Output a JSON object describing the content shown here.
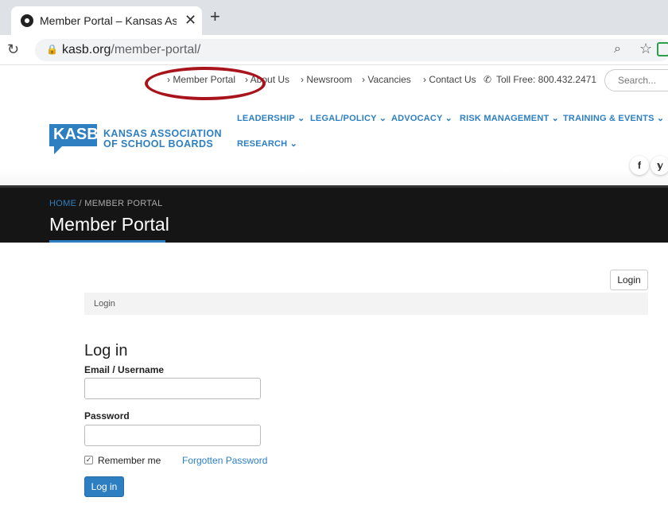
{
  "browser": {
    "tab_title": "Member Portal – Kansas Associa",
    "tab_close": "✕",
    "new_tab": "+",
    "url_domain": "kasb.org",
    "url_path": "/member-portal/"
  },
  "util_nav": {
    "items": [
      {
        "label": "› Member Portal"
      },
      {
        "label": "› About Us"
      },
      {
        "label": "› Newsroom"
      },
      {
        "label": "› Vacancies"
      },
      {
        "label": "› Contact Us"
      }
    ],
    "phone": "Toll Free: 800.432.2471",
    "search_placeholder": "Search..."
  },
  "header": {
    "logo_mark": "KASB",
    "logo_line1": "KANSAS ASSOCIATION",
    "logo_line2": "OF SCHOOL BOARDS",
    "main_nav": [
      {
        "label": "LEADERSHIP ⌄"
      },
      {
        "label": "LEGAL/POLICY ⌄"
      },
      {
        "label": "ADVOCACY ⌄"
      },
      {
        "label": "RISK MANAGEMENT ⌄"
      },
      {
        "label": "TRAINING & EVENTS ⌄"
      },
      {
        "label": "RESEARCH ⌄"
      }
    ],
    "social": [
      "f",
      "𝕪"
    ]
  },
  "banner": {
    "crumb_home": "HOME",
    "crumb_sep": " / ",
    "crumb_current": "MEMBER PORTAL",
    "title": "Member Portal"
  },
  "content": {
    "login_top_button": "Login",
    "crumb_bar": "Login",
    "heading": "Log in",
    "email_label": "Email / Username",
    "password_label": "Password",
    "remember_label": "Remember me",
    "forgot_link": "Forgotten Password",
    "submit_label": "Log in"
  },
  "annotation": {
    "color": "#a8141b"
  },
  "colors": {
    "brand": "#2d7fc1",
    "banner": "#151515"
  }
}
